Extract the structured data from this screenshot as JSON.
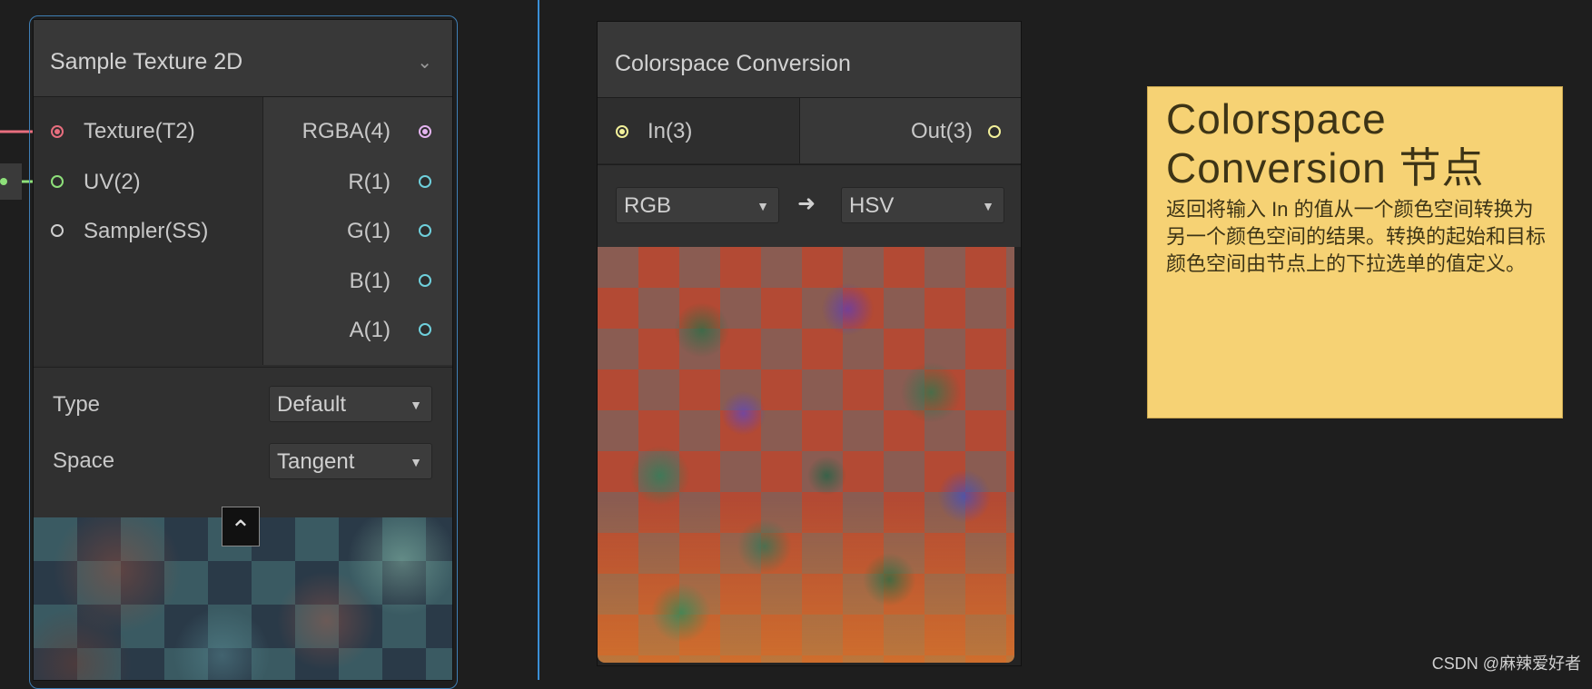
{
  "node_sample": {
    "title": "Sample Texture 2D",
    "inputs": [
      "Texture(T2)",
      "UV(2)",
      "Sampler(SS)"
    ],
    "outputs": [
      "RGBA(4)",
      "R(1)",
      "G(1)",
      "B(1)",
      "A(1)"
    ],
    "type_label": "Type",
    "type_value": "Default",
    "space_label": "Space",
    "space_value": "Tangent",
    "collapse_glyph": "⌃"
  },
  "node_convert": {
    "title": "Colorspace Conversion",
    "input": "In(3)",
    "output": "Out(3)",
    "from_value": "RGB",
    "arrow": "➜",
    "to_value": "HSV"
  },
  "sticky": {
    "title_line1": "Colorspace",
    "title_line2": "Conversion 节点",
    "body": "返回将输入 In 的值从一个颜色空间转换为另一个颜色空间的结果。转换的起始和目标颜色空间由节点上的下拉选单的值定义。"
  },
  "watermark": "CSDN @麻辣爱好者",
  "colors": {
    "accent_blue": "#3a8fd6",
    "texture_port": "#e86e7e",
    "uv_port": "#8ee07a",
    "vector4_port": "#e4b4f0",
    "float_port": "#6fd0dc",
    "vector3_port": "#f2f09a",
    "sticky_bg": "#f6d274"
  }
}
